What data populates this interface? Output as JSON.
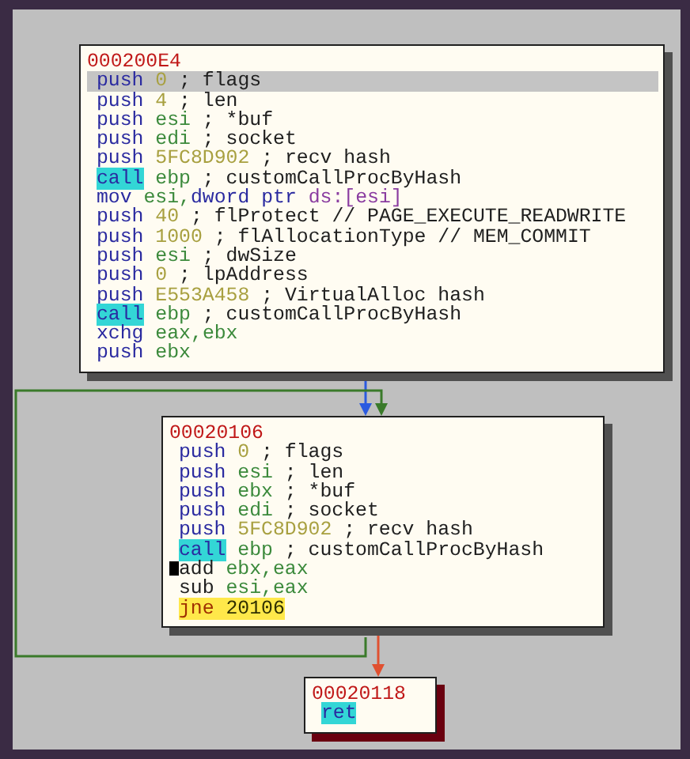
{
  "graph": {
    "nodes": [
      {
        "address": "000200E4",
        "color": "#505050",
        "lines": [
          {
            "selected": true,
            "cursor": false,
            "tokens": [
              {
                "text": "push",
                "kind": "mnemonic"
              },
              {
                "text": " 0",
                "kind": "number"
              },
              {
                "text": " ; flags",
                "kind": "comment"
              }
            ]
          },
          {
            "selected": false,
            "cursor": false,
            "tokens": [
              {
                "text": "push",
                "kind": "mnemonic"
              },
              {
                "text": " 4",
                "kind": "number"
              },
              {
                "text": " ; len",
                "kind": "comment"
              }
            ]
          },
          {
            "selected": false,
            "cursor": false,
            "tokens": [
              {
                "text": "push",
                "kind": "mnemonic"
              },
              {
                "text": " esi",
                "kind": "register"
              },
              {
                "text": " ; *buf",
                "kind": "comment"
              }
            ]
          },
          {
            "selected": false,
            "cursor": false,
            "tokens": [
              {
                "text": "push",
                "kind": "mnemonic"
              },
              {
                "text": " edi",
                "kind": "register"
              },
              {
                "text": " ; socket",
                "kind": "comment"
              }
            ]
          },
          {
            "selected": false,
            "cursor": false,
            "tokens": [
              {
                "text": "push",
                "kind": "mnemonic"
              },
              {
                "text": " 5FC8D902",
                "kind": "number"
              },
              {
                "text": " ; recv hash",
                "kind": "comment"
              }
            ]
          },
          {
            "selected": false,
            "cursor": false,
            "tokens": [
              {
                "text": "call",
                "kind": "call"
              },
              {
                "text": " ebp",
                "kind": "register"
              },
              {
                "text": " ; customCallProcByHash",
                "kind": "comment"
              }
            ]
          },
          {
            "selected": false,
            "cursor": false,
            "tokens": [
              {
                "text": "mov",
                "kind": "mnemonic"
              },
              {
                "text": " esi,",
                "kind": "register"
              },
              {
                "text": "dword ptr",
                "kind": "mnemonic"
              },
              {
                "text": " ds:[esi]",
                "kind": "segment"
              }
            ]
          },
          {
            "selected": false,
            "cursor": false,
            "tokens": [
              {
                "text": "push",
                "kind": "mnemonic"
              },
              {
                "text": " 40",
                "kind": "number"
              },
              {
                "text": " ; flProtect // PAGE_EXECUTE_READWRITE",
                "kind": "comment"
              }
            ]
          },
          {
            "selected": false,
            "cursor": false,
            "tokens": [
              {
                "text": "push",
                "kind": "mnemonic"
              },
              {
                "text": " 1000",
                "kind": "number"
              },
              {
                "text": " ; flAllocationType // MEM_COMMIT",
                "kind": "comment"
              }
            ]
          },
          {
            "selected": false,
            "cursor": false,
            "tokens": [
              {
                "text": "push",
                "kind": "mnemonic"
              },
              {
                "text": " esi",
                "kind": "register"
              },
              {
                "text": " ; dwSize",
                "kind": "comment"
              }
            ]
          },
          {
            "selected": false,
            "cursor": false,
            "tokens": [
              {
                "text": "push",
                "kind": "mnemonic"
              },
              {
                "text": " 0",
                "kind": "number"
              },
              {
                "text": " ; lpAddress",
                "kind": "comment"
              }
            ]
          },
          {
            "selected": false,
            "cursor": false,
            "tokens": [
              {
                "text": "push",
                "kind": "mnemonic"
              },
              {
                "text": " E553A458",
                "kind": "number"
              },
              {
                "text": " ; VirtualAlloc hash",
                "kind": "comment"
              }
            ]
          },
          {
            "selected": false,
            "cursor": false,
            "tokens": [
              {
                "text": "call",
                "kind": "call"
              },
              {
                "text": " ebp",
                "kind": "register"
              },
              {
                "text": " ; customCallProcByHash",
                "kind": "comment"
              }
            ]
          },
          {
            "selected": false,
            "cursor": false,
            "tokens": [
              {
                "text": "xchg",
                "kind": "mnemonic"
              },
              {
                "text": " eax,",
                "kind": "register"
              },
              {
                "text": "ebx",
                "kind": "register"
              }
            ]
          },
          {
            "selected": false,
            "cursor": false,
            "tokens": [
              {
                "text": "push",
                "kind": "mnemonic"
              },
              {
                "text": " ebx",
                "kind": "register"
              }
            ]
          }
        ]
      },
      {
        "address": "00020106",
        "color": "#505050",
        "lines": [
          {
            "selected": false,
            "cursor": false,
            "tokens": [
              {
                "text": "push",
                "kind": "mnemonic"
              },
              {
                "text": " 0",
                "kind": "number"
              },
              {
                "text": " ; flags",
                "kind": "comment"
              }
            ]
          },
          {
            "selected": false,
            "cursor": false,
            "tokens": [
              {
                "text": "push",
                "kind": "mnemonic"
              },
              {
                "text": " esi",
                "kind": "register"
              },
              {
                "text": " ; len",
                "kind": "comment"
              }
            ]
          },
          {
            "selected": false,
            "cursor": false,
            "tokens": [
              {
                "text": "push",
                "kind": "mnemonic"
              },
              {
                "text": " ebx",
                "kind": "register"
              },
              {
                "text": " ; *buf",
                "kind": "comment"
              }
            ]
          },
          {
            "selected": false,
            "cursor": false,
            "tokens": [
              {
                "text": "push",
                "kind": "mnemonic"
              },
              {
                "text": " edi",
                "kind": "register"
              },
              {
                "text": " ; socket",
                "kind": "comment"
              }
            ]
          },
          {
            "selected": false,
            "cursor": false,
            "tokens": [
              {
                "text": "push",
                "kind": "mnemonic"
              },
              {
                "text": " 5FC8D902",
                "kind": "number"
              },
              {
                "text": " ; recv hash",
                "kind": "comment"
              }
            ]
          },
          {
            "selected": false,
            "cursor": false,
            "tokens": [
              {
                "text": "call",
                "kind": "call"
              },
              {
                "text": " ebp",
                "kind": "register"
              },
              {
                "text": " ; customCallProcByHash",
                "kind": "comment"
              }
            ]
          },
          {
            "selected": false,
            "cursor": true,
            "tokens": [
              {
                "text": "add",
                "kind": "plain"
              },
              {
                "text": " ebx,",
                "kind": "register"
              },
              {
                "text": "eax",
                "kind": "register"
              }
            ]
          },
          {
            "selected": false,
            "cursor": false,
            "tokens": [
              {
                "text": "sub",
                "kind": "plain"
              },
              {
                "text": " esi,",
                "kind": "register"
              },
              {
                "text": "eax",
                "kind": "register"
              }
            ]
          },
          {
            "selected": false,
            "cursor": false,
            "tokens": [
              {
                "text": "jne",
                "kind": "jump"
              },
              {
                "text": " 20106",
                "kind": "target"
              }
            ]
          }
        ]
      },
      {
        "address": "00020118",
        "color": "#6a0010",
        "lines": [
          {
            "selected": false,
            "cursor": false,
            "tokens": [
              {
                "text": "ret",
                "kind": "call"
              }
            ]
          }
        ]
      }
    ]
  }
}
